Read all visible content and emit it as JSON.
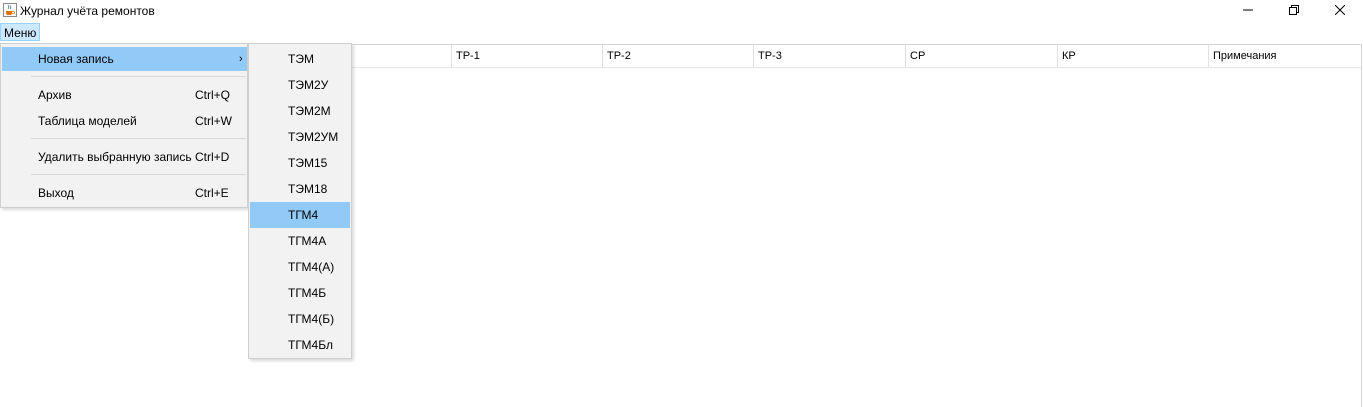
{
  "window": {
    "title": "Журнал учёта ремонтов",
    "icons": {
      "app": "java-cup-icon",
      "minimize": "minimize-icon",
      "maximize": "restore-icon",
      "close": "close-icon"
    }
  },
  "menubar": {
    "menu_label": "Меню"
  },
  "table": {
    "columns": [
      "",
      "ТР-1",
      "ТР-2",
      "ТР-3",
      "СР",
      "КР",
      "Примечания"
    ]
  },
  "menu": {
    "items": [
      {
        "label": "Новая запись",
        "shortcut": "",
        "submenu": true,
        "highlighted": true
      },
      {
        "label": "Архив",
        "shortcut": "Ctrl+Q"
      },
      {
        "label": "Таблица моделей",
        "shortcut": "Ctrl+W"
      },
      {
        "label": "Удалить выбранную запись",
        "shortcut": "Ctrl+D"
      },
      {
        "label": "Выход",
        "shortcut": "Ctrl+E"
      }
    ],
    "submenu_arrow": "›"
  },
  "submenu": {
    "items": [
      "ТЭМ",
      "ТЭМ2У",
      "ТЭМ2М",
      "ТЭМ2УМ",
      "ТЭМ15",
      "ТЭМ18",
      "ТГМ4",
      "ТГМ4А",
      "ТГМ4(А)",
      "ТГМ4Б",
      "ТГМ4(Б)",
      "ТГМ4Бл"
    ],
    "highlighted_index": 6
  },
  "colors": {
    "highlight": "#91c9f7",
    "menu_bg": "#f2f2f2",
    "menubar_selected": "#cce8ff"
  }
}
